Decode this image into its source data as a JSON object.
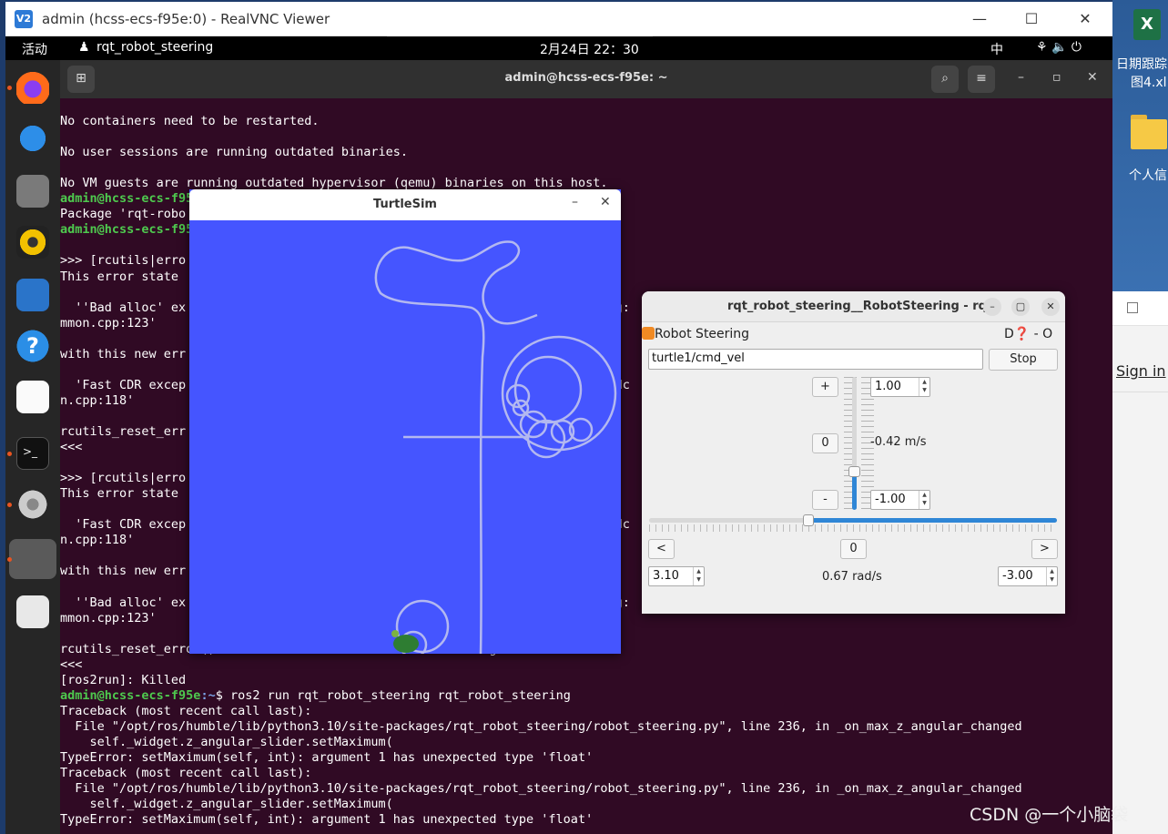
{
  "desktop": {
    "excel_label_line1": "日期跟踪",
    "excel_label_line2": "图4.xl",
    "folder_label": "个人信",
    "sign_in": "Sign in"
  },
  "vnc": {
    "title": "admin (hcss-ecs-f95e:0) - RealVNC Viewer",
    "minimize": "—",
    "maximize": "☐",
    "close": "✕"
  },
  "gnome": {
    "activities": "活动",
    "app": "rqt_robot_steering",
    "clock": "2月24日  22：30",
    "ime": "中",
    "tray": "⚘  🔈  ⏻"
  },
  "terminal": {
    "title": "admin@hcss-ecs-f95e: ~",
    "lines": [
      {
        "t": ""
      },
      {
        "t": "No containers need to be restarted."
      },
      {
        "t": ""
      },
      {
        "t": "No user sessions are running outdated binaries."
      },
      {
        "t": ""
      },
      {
        "t": "No VM guests are running outdated hypervisor (qemu) binaries on this host."
      },
      {
        "t": "admin@hcss-ecs-f95e",
        "c": "g"
      },
      {
        "t": "Package 'rqt-robo"
      },
      {
        "t": "admin@hcss-ecs-f95e",
        "c": "g"
      },
      {
        "t": ""
      },
      {
        "t": ">>> [rcutils|erro"
      },
      {
        "t": "This error state"
      },
      {
        "t": ""
      },
      {
        "t": "  ''Bad alloc' ex                                                         sg:                                             t_co"
      },
      {
        "t": "mmon.cpp:123'"
      },
      {
        "t": ""
      },
      {
        "t": "with this new err"
      },
      {
        "t": ""
      },
      {
        "t": "  'Fast CDR excep                                                         :dc                                             ommo"
      },
      {
        "t": "n.cpp:118'"
      },
      {
        "t": ""
      },
      {
        "t": "rcutils_reset_err                                                         s."
      },
      {
        "t": "<<<"
      },
      {
        "t": ""
      },
      {
        "t": ">>> [rcutils|erro"
      },
      {
        "t": "This error state"
      },
      {
        "t": ""
      },
      {
        "t": "  'Fast CDR excep                                                         :dc                                             ommo"
      },
      {
        "t": "n.cpp:118'"
      },
      {
        "t": ""
      },
      {
        "t": "with this new err"
      },
      {
        "t": ""
      },
      {
        "t": "  ''Bad alloc' ex                                                         sg:                                             t_co"
      },
      {
        "t": "mmon.cpp:123'"
      },
      {
        "t": ""
      },
      {
        "t": "rcutils_reset_error() should be called after error handling to avoid this."
      },
      {
        "t": "<<<"
      },
      {
        "t": "[ros2run]: Killed"
      },
      {
        "t": "",
        "prompt": "admin@hcss-ecs-f95e",
        "rest": "$ ros2 run rqt_robot_steering rqt_robot_steering"
      },
      {
        "t": "Traceback (most recent call last):"
      },
      {
        "t": "  File \"/opt/ros/humble/lib/python3.10/site-packages/rqt_robot_steering/robot_steering.py\", line 236, in _on_max_z_angular_changed"
      },
      {
        "t": "    self._widget.z_angular_slider.setMaximum("
      },
      {
        "t": "TypeError: setMaximum(self, int): argument 1 has unexpected type 'float'"
      },
      {
        "t": "Traceback (most recent call last):"
      },
      {
        "t": "  File \"/opt/ros/humble/lib/python3.10/site-packages/rqt_robot_steering/robot_steering.py\", line 236, in _on_max_z_angular_changed"
      },
      {
        "t": "    self._widget.z_angular_slider.setMaximum("
      },
      {
        "t": "TypeError: setMaximum(self, int): argument 1 has unexpected type 'float'"
      }
    ]
  },
  "turtlesim": {
    "title": "TurtleSim",
    "minimize": "–",
    "close": "✕",
    "background": "#4555ff",
    "path_color": "#b3b8f0"
  },
  "rqt": {
    "title": "rqt_robot_steering__RobotSteering - rqt",
    "plugin_label": "Robot Steering",
    "plugin_help": "D❓ - O",
    "topic": "turtle1/cmd_vel",
    "stop": "Stop",
    "plus": "+",
    "zero": "0",
    "minus": "-",
    "max_linear": "1.00",
    "min_linear": "-1.00",
    "linear_value": "-0.42 m/s",
    "linear_fraction": 0.29,
    "left": "<",
    "right": ">",
    "zero_angular": "0",
    "max_angular": "3.10",
    "angular_value": "0.67 rad/s",
    "min_angular": "-3.00",
    "angular_fraction": 0.39
  },
  "watermark": "CSDN @一个小脑袋"
}
